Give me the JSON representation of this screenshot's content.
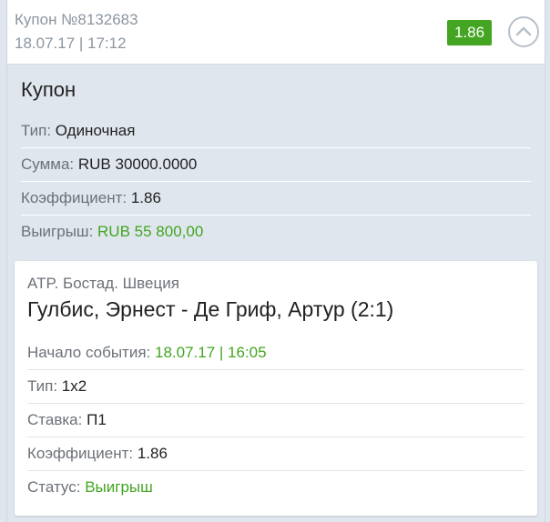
{
  "header": {
    "coupon_number": "Купон №8132683",
    "datetime": "18.07.17 | 17:12",
    "odds": "1.86"
  },
  "coupon": {
    "title": "Купон",
    "rows": [
      {
        "label": "Тип:",
        "value": "Одиночная",
        "value_color": "#222222"
      },
      {
        "label": "Сумма:",
        "value": "RUB 30000.0000",
        "value_color": "#222222"
      },
      {
        "label": "Коэффициент:",
        "value": "1.86",
        "value_color": "#222222"
      },
      {
        "label": "Выигрыш:",
        "value": "RUB 55 800,00",
        "value_color": "#43a521"
      }
    ]
  },
  "event": {
    "league": "ATP. Бостад. Швеция",
    "title": "Гулбис, Эрнест - Де Гриф, Артур (2:1)",
    "rows": [
      {
        "label": "Начало события:",
        "value": "18.07.17 | 16:05",
        "value_color": "#43a521"
      },
      {
        "label": "Тип:",
        "value": "1х2",
        "value_color": "#222222"
      },
      {
        "label": "Ставка:",
        "value": "П1",
        "value_color": "#222222"
      },
      {
        "label": "Коэффициент:",
        "value": "1.86",
        "value_color": "#222222"
      },
      {
        "label": "Статус:",
        "value": "Выигрыш",
        "value_color": "#43a521"
      }
    ]
  },
  "icons": {
    "collapse": "chevron-up-icon"
  },
  "colors": {
    "accent_green": "#43a521",
    "muted_text": "#8c96a0",
    "background": "#dfe6ed"
  }
}
